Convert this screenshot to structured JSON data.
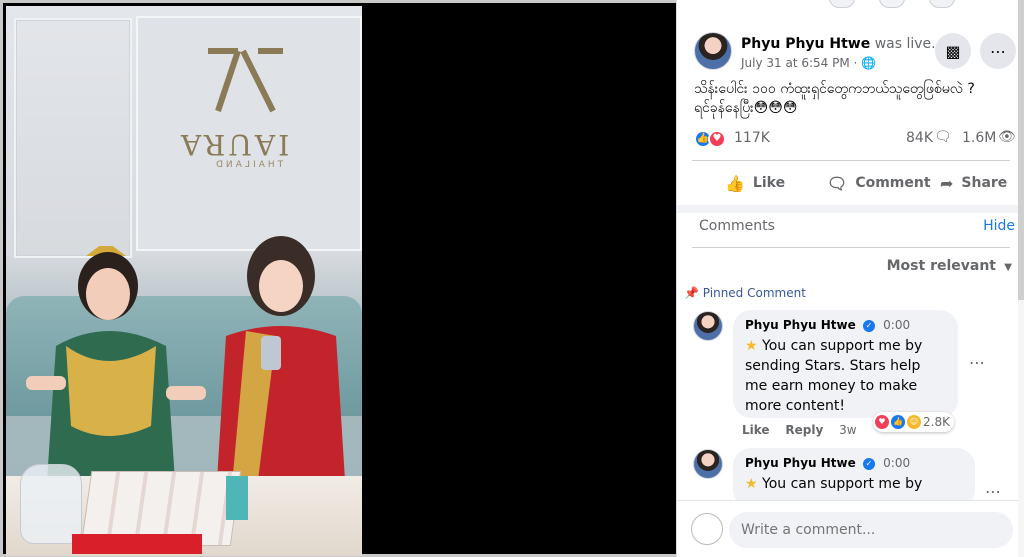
{
  "post": {
    "author": "Phyu Phyu Htwe",
    "status": "was live.",
    "timestamp": "July 31 at 6:54 PM",
    "separator": "·",
    "privacy_icon": "globe-icon",
    "text_line1": "သိန်းပေါင်း ၁၀၀ ကံထူးရှင်တွေကဘယ်သူတွေဖြစ်မလဲ ?",
    "text_line2": "ရင်ခုန်နေပြီး😳😳😳",
    "reactions_count": "117K",
    "comments_count": "84K",
    "views_count": "1.6M"
  },
  "actions": {
    "like": "Like",
    "comment": "Comment",
    "share": "Share"
  },
  "comments_section": {
    "title": "Comments",
    "hide": "Hide",
    "sort": "Most relevant",
    "pinned_label": "Pinned Comment"
  },
  "comments": [
    {
      "author": "Phyu Phyu Htwe",
      "time": "0:00",
      "text": "You can support me by sending Stars. Stars help me earn money to make more content!",
      "reaction_count": "2.8K",
      "like": "Like",
      "reply": "Reply",
      "age": "3w"
    },
    {
      "author": "Phyu Phyu Htwe",
      "time": "0:00",
      "text": "You can support me by"
    }
  ],
  "write": {
    "placeholder": "Write a comment..."
  },
  "video": {
    "brand": "IAURA",
    "brand_sub": "THAILAND"
  },
  "colors": {
    "accent": "#1877f2",
    "love": "#f33e58",
    "text": "#050505",
    "muted": "#65676b"
  }
}
